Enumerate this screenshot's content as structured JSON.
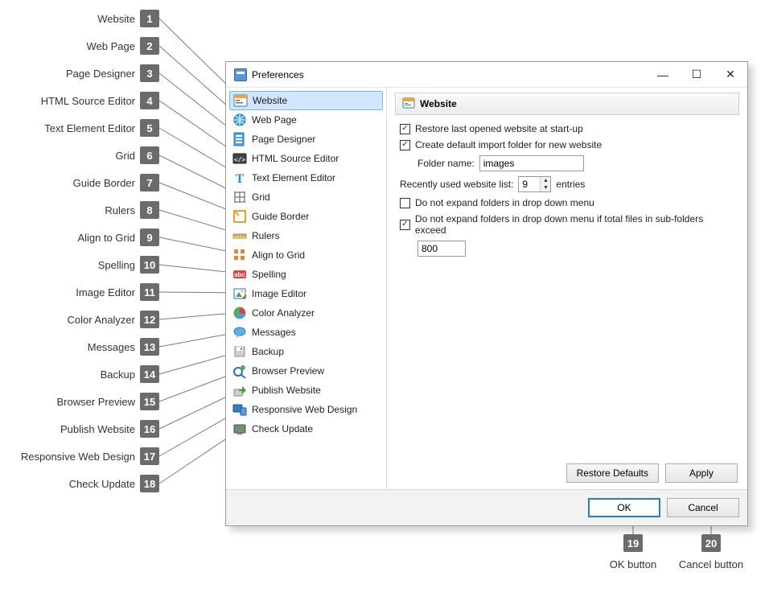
{
  "dialog": {
    "title": "Preferences",
    "content_heading": "Website"
  },
  "sidebar": {
    "items": [
      {
        "label": "Website",
        "icon": "website",
        "selected": true
      },
      {
        "label": "Web Page",
        "icon": "webpage",
        "selected": false
      },
      {
        "label": "Page Designer",
        "icon": "pagedesigner",
        "selected": false
      },
      {
        "label": "HTML Source Editor",
        "icon": "htmlsource",
        "selected": false
      },
      {
        "label": "Text Element Editor",
        "icon": "textelement",
        "selected": false
      },
      {
        "label": "Grid",
        "icon": "grid",
        "selected": false
      },
      {
        "label": "Guide Border",
        "icon": "guideborder",
        "selected": false
      },
      {
        "label": "Rulers",
        "icon": "rulers",
        "selected": false
      },
      {
        "label": "Align to Grid",
        "icon": "aligngrid",
        "selected": false
      },
      {
        "label": "Spelling",
        "icon": "spelling",
        "selected": false
      },
      {
        "label": "Image Editor",
        "icon": "imageeditor",
        "selected": false
      },
      {
        "label": "Color Analyzer",
        "icon": "coloranalyzer",
        "selected": false
      },
      {
        "label": "Messages",
        "icon": "messages",
        "selected": false
      },
      {
        "label": "Backup",
        "icon": "backup",
        "selected": false
      },
      {
        "label": "Browser Preview",
        "icon": "browserpreview",
        "selected": false
      },
      {
        "label": "Publish Website",
        "icon": "publish",
        "selected": false
      },
      {
        "label": "Responsive Web Design",
        "icon": "responsive",
        "selected": false
      },
      {
        "label": "Check Update",
        "icon": "checkupdate",
        "selected": false
      }
    ]
  },
  "options": {
    "restore_last": {
      "checked": true,
      "label": "Restore last opened website at start-up"
    },
    "create_default_folder": {
      "checked": true,
      "label": "Create default import folder for new website"
    },
    "folder_name_label": "Folder name:",
    "folder_name_value": "images",
    "recent_list_label": "Recently used website list:",
    "recent_list_value": "9",
    "recent_list_suffix": "entries",
    "no_expand": {
      "checked": false,
      "label": "Do not expand folders in drop down menu"
    },
    "no_expand_exceed": {
      "checked": true,
      "label": "Do not expand folders in drop down menu if total files in sub-folders exceed"
    },
    "exceed_value": "800"
  },
  "buttons": {
    "restore_defaults": "Restore Defaults",
    "apply": "Apply",
    "ok": "OK",
    "cancel": "Cancel"
  },
  "callouts": {
    "left": [
      {
        "n": "1",
        "label": "Website"
      },
      {
        "n": "2",
        "label": "Web Page"
      },
      {
        "n": "3",
        "label": "Page Designer"
      },
      {
        "n": "4",
        "label": "HTML Source Editor"
      },
      {
        "n": "5",
        "label": "Text Element Editor"
      },
      {
        "n": "6",
        "label": "Grid"
      },
      {
        "n": "7",
        "label": "Guide Border"
      },
      {
        "n": "8",
        "label": "Rulers"
      },
      {
        "n": "9",
        "label": "Align to Grid"
      },
      {
        "n": "10",
        "label": "Spelling"
      },
      {
        "n": "11",
        "label": "Image Editor"
      },
      {
        "n": "12",
        "label": "Color Analyzer"
      },
      {
        "n": "13",
        "label": "Messages"
      },
      {
        "n": "14",
        "label": "Backup"
      },
      {
        "n": "15",
        "label": "Browser Preview"
      },
      {
        "n": "16",
        "label": "Publish Website"
      },
      {
        "n": "17",
        "label": "Responsive Web Design"
      },
      {
        "n": "18",
        "label": "Check Update"
      }
    ],
    "bottom": [
      {
        "n": "19",
        "label": "OK button"
      },
      {
        "n": "20",
        "label": "Cancel button"
      }
    ]
  }
}
